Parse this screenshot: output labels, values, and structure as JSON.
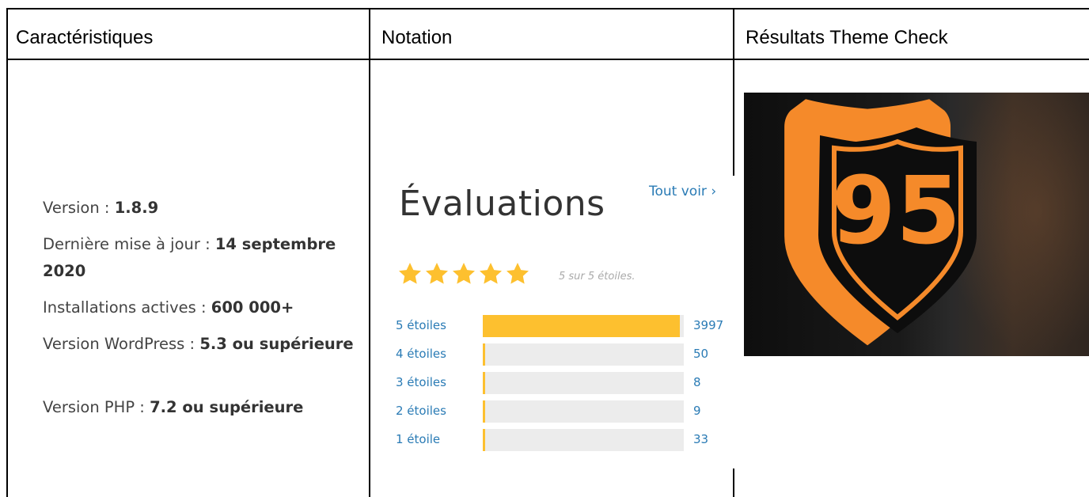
{
  "headers": [
    "Caractéristiques",
    "Notation",
    "Résultats Theme Check"
  ],
  "specs": [
    {
      "label": "Version : ",
      "value": "1.8.9"
    },
    {
      "label": "Dernière mise à jour : ",
      "value": "14 septembre 2020"
    },
    {
      "label": "Installations actives : ",
      "value": "600 000+"
    },
    {
      "label": "Version WordPress : ",
      "value": "5.3 ou supérieure"
    },
    {
      "label": "Version PHP : ",
      "value": "7.2 ou supérieure"
    }
  ],
  "ratings": {
    "title": "Évaluations",
    "view_all": "Tout voir ›",
    "stars_text": "5 sur 5 étoiles.",
    "stars_filled": 5,
    "star_color": "#fdc02f",
    "rows": [
      {
        "label": "5 étoiles",
        "count": "3997",
        "fraction": 0.98
      },
      {
        "label": "4 étoiles",
        "count": "50",
        "fraction": 0.012
      },
      {
        "label": "3 étoiles",
        "count": "8",
        "fraction": 0.002
      },
      {
        "label": "2 étoiles",
        "count": "9",
        "fraction": 0.002
      },
      {
        "label": "1 étoile",
        "count": "33",
        "fraction": 0.008
      }
    ]
  },
  "theme_check": {
    "score": "95",
    "icon": "shield-icon",
    "accent": "#f58a2a"
  }
}
